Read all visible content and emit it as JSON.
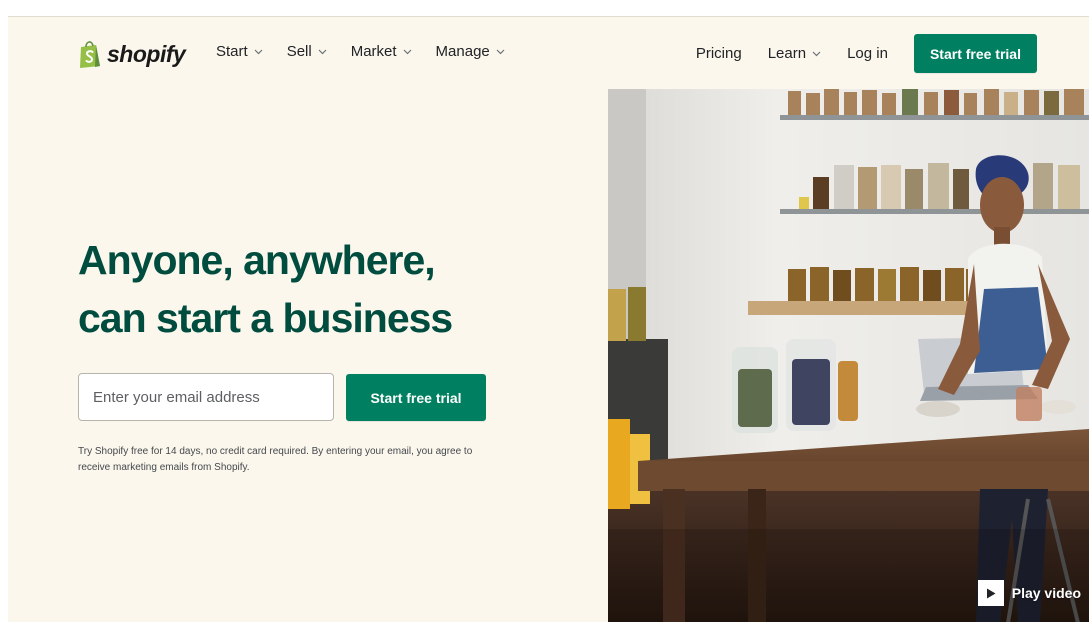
{
  "header": {
    "logo_text": "shopify",
    "nav_left": [
      {
        "label": "Start"
      },
      {
        "label": "Sell"
      },
      {
        "label": "Market"
      },
      {
        "label": "Manage"
      }
    ],
    "pricing_label": "Pricing",
    "learn_label": "Learn",
    "login_label": "Log in",
    "cta_label": "Start free trial"
  },
  "hero": {
    "headline_line1": "Anyone, anywhere,",
    "headline_line2": "can start a business",
    "email_placeholder": "Enter your email address",
    "email_value": "",
    "cta_label": "Start free trial",
    "disclaimer": "Try Shopify free for 14 days, no credit card required. By entering your email, you agree to receive marketing emails from Shopify.",
    "play_video_label": "Play video"
  },
  "icons": {
    "logo": "shopping-bag-icon",
    "nav_chevron": "chevron-down-icon",
    "play": "play-icon"
  },
  "colors": {
    "brand_green": "#008060",
    "headline_green": "#004c3f",
    "background": "#fbf7ed",
    "logo_green": "#95bf47"
  }
}
